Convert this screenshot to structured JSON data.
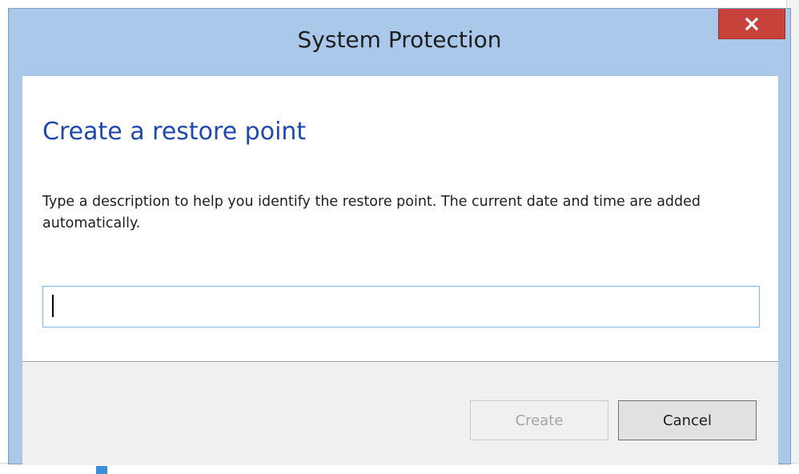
{
  "window": {
    "title": "System Protection",
    "close_icon": "close-icon"
  },
  "dialog": {
    "heading": "Create a restore point",
    "description": "Type a description to help you identify the restore point. The current date and time are added automatically.",
    "input_value": "",
    "create_label": "Create",
    "cancel_label": "Cancel",
    "create_enabled": false
  },
  "colors": {
    "titlebar": "#aac9ea",
    "close_button": "#c7423a",
    "heading": "#1f49b0",
    "input_border": "#7eb4ea",
    "footer": "#f0f0f0"
  }
}
